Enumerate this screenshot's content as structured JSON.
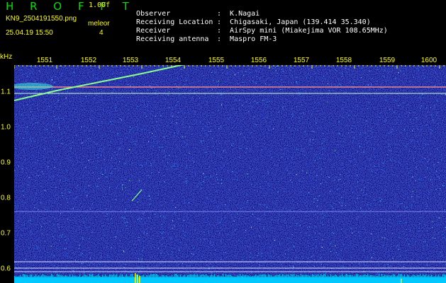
{
  "header": {
    "app_title": "H R O F F T",
    "version": "1.00f",
    "filename": "KN9_2504191550.png",
    "datetime": "25.04.19 15:50",
    "mode_label": "meleor",
    "mode_value": "4"
  },
  "info": [
    {
      "label": "Observer",
      "sep": ":",
      "value": "K.Nagai"
    },
    {
      "label": "Receiving Location",
      "sep": ":",
      "value": "Chigasaki, Japan (139.414 35.340)"
    },
    {
      "label": "Receiver",
      "sep": ":",
      "value": "AirSpy mini (Miakejima VOR 108.65MHz)"
    },
    {
      "label": "Receiving antenna",
      "sep": ":",
      "value": "Maspro FM-3"
    }
  ],
  "axes": {
    "y_unit": "kHz",
    "x_ticks": [
      "1551",
      "1552",
      "1553",
      "1554",
      "1555",
      "1556",
      "1557",
      "1558",
      "1559",
      "1600"
    ],
    "y_ticks": [
      "1.1",
      "1.0",
      "0.9",
      "0.8",
      "0.7",
      "0.6"
    ]
  },
  "colors": {
    "background": "#000000",
    "noise_base": "#0a0a8c",
    "trace_line": "#ffffff",
    "meteor_trace": "#80ff80",
    "label_yellow": "#ffff00",
    "title_green": "#00e000",
    "baseline_cyan": "#00c8ff"
  }
}
